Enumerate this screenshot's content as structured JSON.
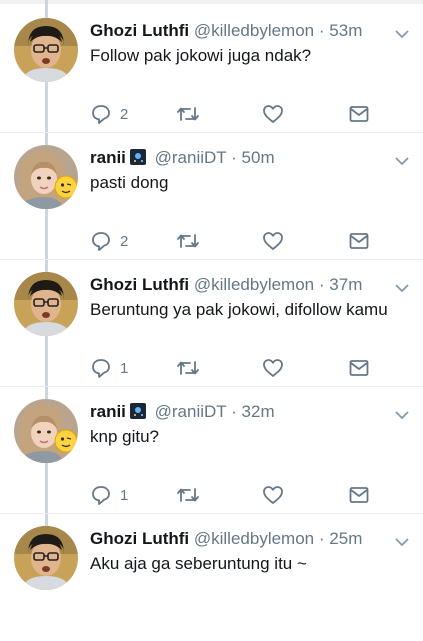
{
  "colors": {
    "icon": "#657786",
    "text": "#14171a",
    "muted": "#657786",
    "thread_line": "#ccd6dd"
  },
  "icons": {
    "reply": "reply-icon",
    "retweet": "retweet-icon",
    "like": "heart-icon",
    "dm": "envelope-icon",
    "menu": "chevron-down-icon",
    "badge": "gaming-badge-icon"
  },
  "tweets": [
    {
      "name": "Ghozi Luthfi",
      "handle": "@killedbylemon",
      "sep": "·",
      "time": "53m",
      "text": "Follow pak jokowi juga ndak?",
      "replies": "2"
    },
    {
      "name": "ranii",
      "handle": "@raniiDT",
      "sep": "·",
      "time": "50m",
      "text": "pasti dong",
      "replies": "2"
    },
    {
      "name": "Ghozi Luthfi",
      "handle": "@killedbylemon",
      "sep": "·",
      "time": "37m",
      "text": "Beruntung ya pak jokowi, difollow kamu",
      "replies": "1"
    },
    {
      "name": "ranii",
      "handle": "@raniiDT",
      "sep": "·",
      "time": "32m",
      "text": "knp gitu?",
      "replies": "1"
    },
    {
      "name": "Ghozi Luthfi",
      "handle": "@killedbylemon",
      "sep": "·",
      "time": "25m",
      "text": "Aku aja ga seberuntung itu ~"
    }
  ]
}
